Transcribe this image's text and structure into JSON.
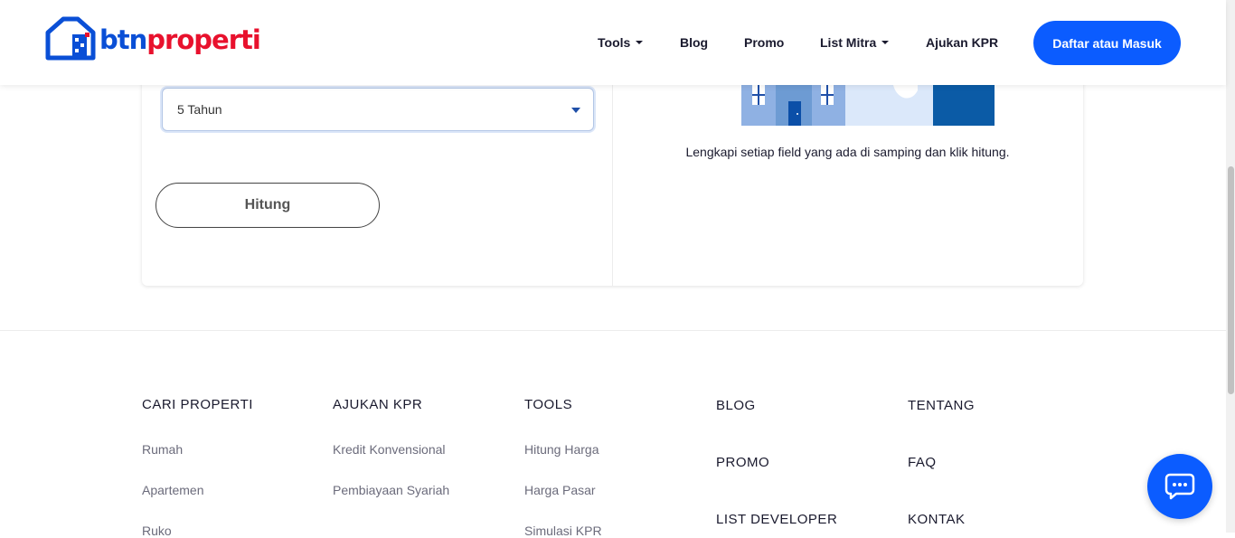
{
  "header": {
    "logo": {
      "part1": "btn",
      "part2": "properti"
    },
    "nav": [
      {
        "label": "Tools",
        "has_dropdown": true
      },
      {
        "label": "Blog",
        "has_dropdown": false
      },
      {
        "label": "Promo",
        "has_dropdown": false
      },
      {
        "label": "List Mitra",
        "has_dropdown": true
      },
      {
        "label": "Ajukan KPR",
        "has_dropdown": false
      }
    ],
    "cta_label": "Daftar atau Masuk"
  },
  "calculator": {
    "tenor_select": {
      "value": "5 Tahun"
    },
    "calculate_label": "Hitung",
    "hint": "Lengkapi setiap field yang ada di samping dan klik hitung."
  },
  "footer": {
    "cari_properti": {
      "title": "CARI PROPERTI",
      "links": [
        "Rumah",
        "Apartemen",
        "Ruko"
      ]
    },
    "ajukan_kpr": {
      "title": "AJUKAN KPR",
      "links": [
        "Kredit Konvensional",
        "Pembiayaan Syariah"
      ]
    },
    "tools": {
      "title": "TOOLS",
      "links": [
        "Hitung Harga",
        "Harga Pasar",
        "Simulasi KPR"
      ]
    },
    "col4": [
      "BLOG",
      "PROMO",
      "LIST DEVELOPER"
    ],
    "col5": [
      "TENTANG",
      "FAQ",
      "KONTAK"
    ]
  },
  "colors": {
    "brand_blue": "#0b5cff",
    "brand_red": "#e8112d",
    "text_dark": "#1a1a2e"
  },
  "icons": {
    "chat": "chat-bubble-icon",
    "caret": "caret-down-icon"
  }
}
